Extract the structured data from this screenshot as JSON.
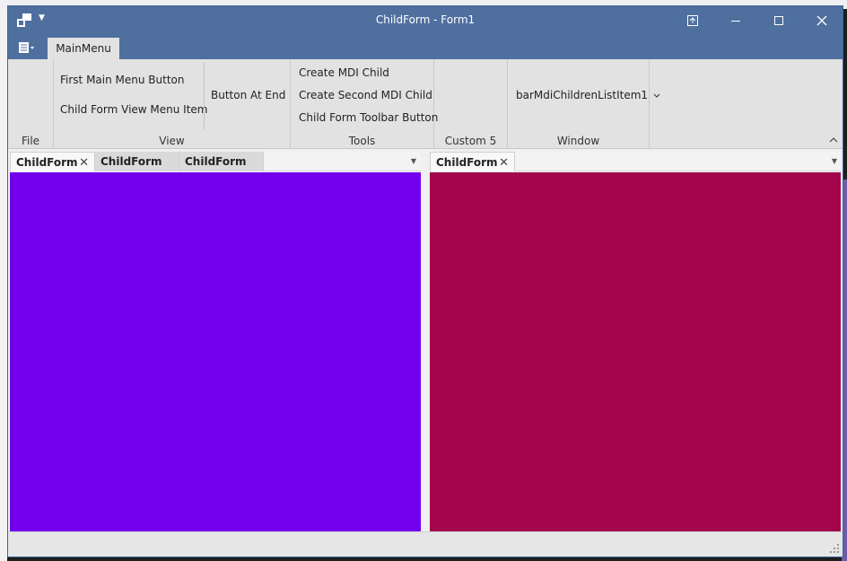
{
  "window": {
    "title": "ChildForm - Form1",
    "colors": {
      "titlebar": "#4f6f9f",
      "ribbon": "#e2e2e2"
    }
  },
  "ribbon": {
    "page_tab": "MainMenu",
    "groups": {
      "file": {
        "label": "File"
      },
      "view": {
        "label": "View",
        "first_main_menu_button": "First Main Menu Button",
        "child_form_view_menu_item": "Child Form View Menu Item",
        "button_at_end": "Button At End"
      },
      "tools": {
        "label": "Tools",
        "create_mdi_child": "Create MDI Child",
        "create_second_mdi_child": "Create Second MDI Child",
        "child_form_toolbar_button": "Child Form Toolbar Button"
      },
      "custom5": {
        "label": "Custom 5"
      },
      "window": {
        "label": "Window",
        "mdi_children_list": "barMdiChildrenListItem1"
      }
    }
  },
  "documents": {
    "left_pane": {
      "tabs": [
        {
          "label": "ChildForm",
          "active": true
        },
        {
          "label": "ChildForm",
          "active": false
        },
        {
          "label": "ChildForm",
          "active": false
        }
      ],
      "color": "#7300ec"
    },
    "right_pane": {
      "tabs": [
        {
          "label": "ChildForm",
          "active": true
        }
      ],
      "color": "#a3064c"
    }
  },
  "icons": {
    "app": "app-menu-icon",
    "quick_access": "chevron-down-icon",
    "restore_to_tab": "restore-to-tab-icon",
    "minimize": "minimize-icon",
    "maximize": "maximize-icon",
    "close": "close-icon",
    "file_menu": "file-menu-icon",
    "collapse_ribbon": "chevron-up-icon",
    "size_grip": "size-grip-icon"
  }
}
